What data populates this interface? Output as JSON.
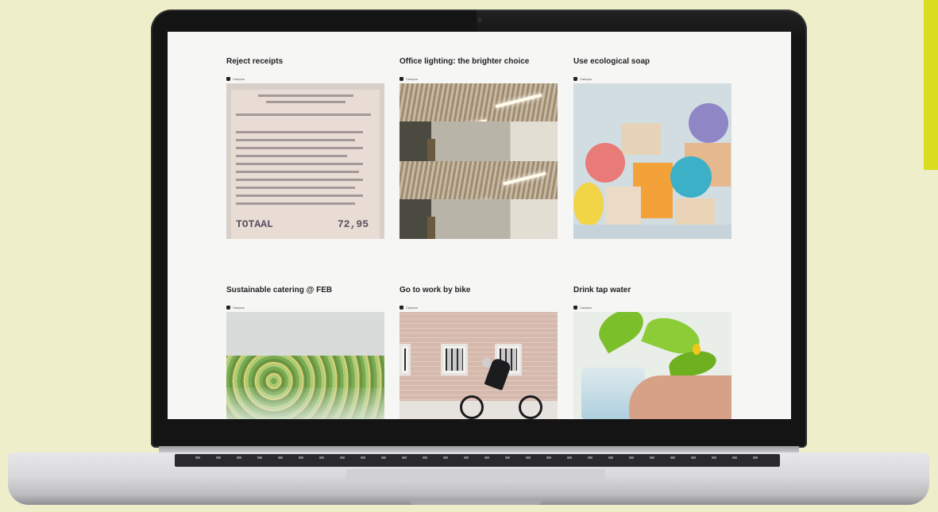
{
  "page": {
    "background": "#efeecb",
    "accent_color": "#d8dd1e"
  },
  "laptop": {
    "bezel_color": "#141414",
    "body_color": "#d9d9db"
  },
  "grid": {
    "cards": [
      {
        "title": "Reject receipts",
        "meta": "Campus",
        "image": "receipt-photo"
      },
      {
        "title": "Office lighting: the brighter choice",
        "meta": "Campus",
        "image": "office-lighting-photo"
      },
      {
        "title": "Use ecological soap",
        "meta": "Campus",
        "image": "ecological-soap-photo"
      },
      {
        "title": "Sustainable catering @ FEB",
        "meta": "Campus",
        "image": "catering-photo"
      },
      {
        "title": "Go to work by bike",
        "meta": "Campus",
        "image": "bike-photo"
      },
      {
        "title": "Drink tap water",
        "meta": "Campus",
        "image": "tap-water-photo"
      }
    ]
  },
  "receipt": {
    "total_label": "TOTAAL",
    "total_amount": "72,95"
  }
}
